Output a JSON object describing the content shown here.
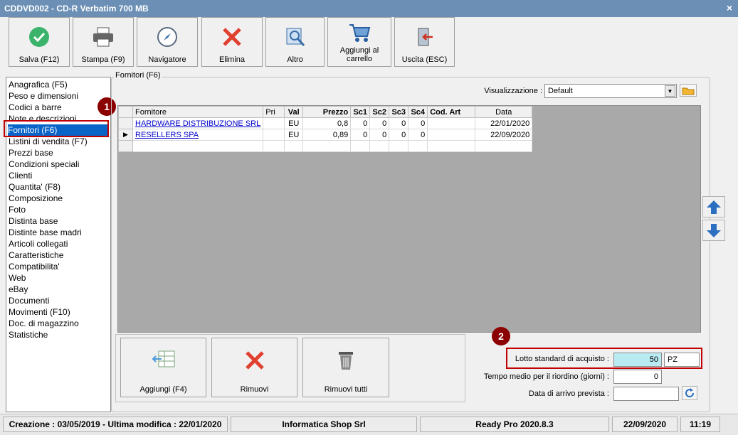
{
  "window": {
    "title": "CDDVD002 - CD-R Verbatim 700 MB",
    "close_glyph": "×"
  },
  "toolbar": [
    {
      "label": "Salva (F12)",
      "icon": "check-icon"
    },
    {
      "label": "Stampa (F9)",
      "icon": "printer-icon"
    },
    {
      "label": "Navigatore",
      "icon": "compass-icon"
    },
    {
      "label": "Elimina",
      "icon": "delete-x-icon"
    },
    {
      "label": "Altro",
      "icon": "magnifier-icon"
    },
    {
      "label": "Aggiungi al carrello",
      "icon": "cart-icon"
    },
    {
      "label": "Uscita (ESC)",
      "icon": "exit-icon"
    }
  ],
  "sidebar": {
    "items": [
      "Anagrafica (F5)",
      "Peso e dimensioni",
      "Codici a barre",
      "Note e descrizioni",
      "Fornitori (F6)",
      "Listini di vendita (F7)",
      "Prezzi base",
      "Condizioni speciali",
      "Clienti",
      "Quantita' (F8)",
      "Composizione",
      "Foto",
      "Distinta base",
      "Distinte base madri",
      "Articoli collegati",
      "Caratteristiche",
      "Compatibilita'",
      "Web",
      "eBay",
      "Documenti",
      "Movimenti (F10)",
      "Doc. di magazzino",
      "Statistiche"
    ],
    "selected_index": 4
  },
  "badges": {
    "one": "1",
    "two": "2"
  },
  "panel": {
    "title": "Fornitori (F6)",
    "view_label": "Visualizzazione :",
    "view_value": "Default"
  },
  "grid": {
    "columns": [
      "Fornitore",
      "Pri",
      "Val",
      "Prezzo",
      "Sc1",
      "Sc2",
      "Sc3",
      "Sc4",
      "Cod. Art",
      "Data"
    ],
    "rows": [
      {
        "fornitore": "HARDWARE DISTRIBUZIONE SRL",
        "pri": "",
        "val": "EU",
        "prezzo": "0,8",
        "sc1": "0",
        "sc2": "0",
        "sc3": "0",
        "sc4": "0",
        "cod": "",
        "data": "22/01/2020",
        "marker": ""
      },
      {
        "fornitore": "RESELLERS SPA",
        "pri": "",
        "val": "EU",
        "prezzo": "0,89",
        "sc1": "0",
        "sc2": "0",
        "sc3": "0",
        "sc4": "0",
        "cod": "",
        "data": "22/09/2020",
        "marker": "▶"
      }
    ]
  },
  "bottom_buttons": [
    {
      "label": "Aggiungi (F4)",
      "icon": "add-row-icon"
    },
    {
      "label": "Rimuovi",
      "icon": "remove-x-icon"
    },
    {
      "label": "Rimuovi tutti",
      "icon": "trash-icon"
    }
  ],
  "fields": {
    "lotto_label": "Lotto standard di acquisto :",
    "lotto_value": "50",
    "lotto_unit": "PZ",
    "tempo_label": "Tempo medio per il riordino (giorni) :",
    "tempo_value": "0",
    "data_arrivo_label": "Data di arrivo prevista :",
    "data_arrivo_value": ""
  },
  "status": {
    "creazione": "Creazione : 03/05/2019 - Ultima modifica : 22/01/2020",
    "company": "Informatica Shop Srl",
    "version": "Ready Pro 2020.8.3",
    "date": "22/09/2020",
    "time": "11:19"
  },
  "colors": {
    "accent": "#0a64c8",
    "highlight": "#c00000",
    "badge": "#8b0000",
    "lotto_bg": "#b8ecf2"
  }
}
